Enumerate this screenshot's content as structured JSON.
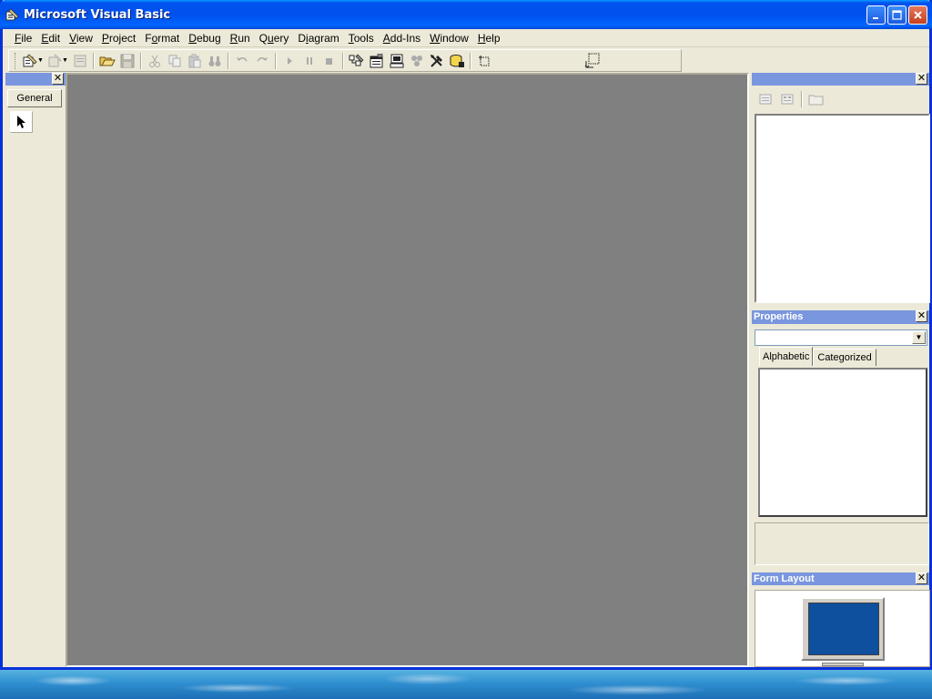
{
  "window": {
    "title": "Microsoft Visual Basic"
  },
  "menu": [
    "File",
    "Edit",
    "View",
    "Project",
    "Format",
    "Debug",
    "Run",
    "Query",
    "Diagram",
    "Tools",
    "Add-Ins",
    "Window",
    "Help"
  ],
  "menu_underline": [
    "F",
    "E",
    "V",
    "P",
    "o",
    "D",
    "R",
    "u",
    "i",
    "T",
    "A",
    "W",
    "H"
  ],
  "toolbar": {
    "icons": [
      "add-project-icon",
      "add-form-icon",
      "menu-editor-icon",
      "open-icon",
      "save-icon",
      "cut-icon",
      "copy-icon",
      "paste-icon",
      "find-icon",
      "undo-icon",
      "redo-icon",
      "start-icon",
      "break-icon",
      "end-icon",
      "project-explorer-icon",
      "properties-window-icon",
      "form-layout-icon",
      "object-browser-icon",
      "toolbox-icon",
      "data-view-icon",
      "component-manager-icon"
    ]
  },
  "toolbox": {
    "tab_label": "General"
  },
  "properties": {
    "title": "Properties",
    "tab_alphabetic": "Alphabetic",
    "tab_categorized": "Categorized"
  },
  "form_layout": {
    "title": "Form Layout"
  },
  "colors": {
    "titlebar": "#0053ee",
    "panel_header": "#7a96df",
    "mdi_background": "#808080",
    "form_layout_screen": "#0e4f9e"
  }
}
